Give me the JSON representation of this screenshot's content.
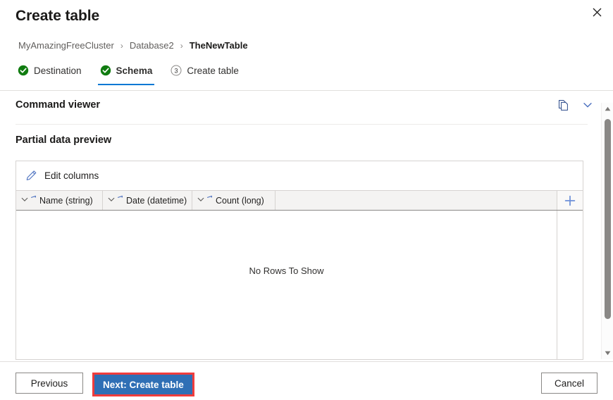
{
  "dialog": {
    "title": "Create table",
    "close_label": "Close"
  },
  "breadcrumb": {
    "separator": "›",
    "items": [
      {
        "label": "MyAmazingFreeCluster",
        "current": false
      },
      {
        "label": "Database2",
        "current": false
      },
      {
        "label": "TheNewTable",
        "current": true
      }
    ]
  },
  "steps": [
    {
      "label": "Destination",
      "state": "complete",
      "number": "1"
    },
    {
      "label": "Schema",
      "state": "complete",
      "number": "2",
      "active": true
    },
    {
      "label": "Create table",
      "state": "pending",
      "number": "3"
    }
  ],
  "command_viewer": {
    "title": "Command viewer",
    "copy_icon": "copy-icon",
    "expand_icon": "chevron-down-icon"
  },
  "preview": {
    "section_label": "Partial data preview",
    "edit_columns_label": "Edit columns",
    "edit_icon": "pencil-icon",
    "add_column_icon": "plus-icon",
    "columns": [
      {
        "label": "Name (string)",
        "name": "Name",
        "type": "string"
      },
      {
        "label": "Date (datetime)",
        "name": "Date",
        "type": "datetime"
      },
      {
        "label": "Count (long)",
        "name": "Count",
        "type": "long"
      }
    ],
    "empty_message": "No Rows To Show",
    "rows": []
  },
  "scrollbar": {
    "up_icon": "triangle-up-icon",
    "down_icon": "triangle-down-icon"
  },
  "footer": {
    "previous_label": "Previous",
    "next_label": "Next: Create table",
    "cancel_label": "Cancel"
  },
  "colors": {
    "accent": "#0078d4",
    "primary_button": "#2f6fb5",
    "highlight": "#f03c3c",
    "step_complete": "#107c10",
    "icon_blue": "#5b7fc7"
  }
}
